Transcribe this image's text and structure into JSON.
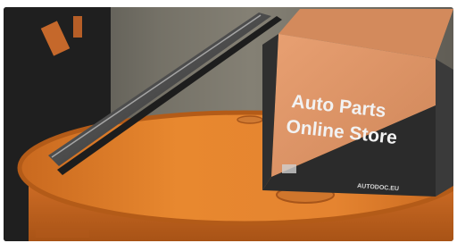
{
  "photo": {
    "subject": "wiper blade on orange oil drum with parts box",
    "box_brand_line1": "Auto Parts",
    "box_brand_line2": "Online Store",
    "box_domain": "AUTODOC.EU",
    "colors": {
      "drum_orange": "#e8872e",
      "box_orange": "#e39a6a",
      "box_dark": "#2b2b2b",
      "background_dark": "#2a2a2a"
    }
  }
}
